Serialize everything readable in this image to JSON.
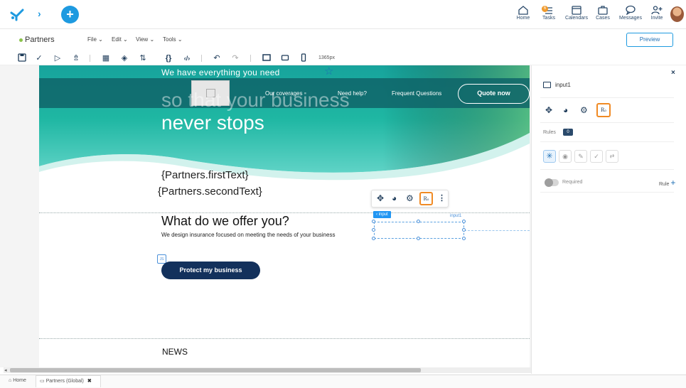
{
  "topbar": {
    "tasks_badge": "6",
    "nav": [
      {
        "id": "home",
        "label": "Home",
        "icon": "home-icon"
      },
      {
        "id": "tasks",
        "label": "Tasks",
        "icon": "tasks-icon"
      },
      {
        "id": "calendars",
        "label": "Calendars",
        "icon": "calendar-icon"
      },
      {
        "id": "cases",
        "label": "Cases",
        "icon": "briefcase-icon"
      },
      {
        "id": "messages",
        "label": "Messages",
        "icon": "chat-icon"
      },
      {
        "id": "invite",
        "label": "Invite",
        "icon": "add-user-icon"
      }
    ],
    "accent": "#1e9ae0"
  },
  "menubar": {
    "title": "Partners",
    "status_color": "#8bc34a",
    "menus": [
      "File",
      "Edit",
      "View",
      "Tools"
    ],
    "preview_label": "Preview"
  },
  "toolbar": {
    "width_label": "1365px"
  },
  "page": {
    "banner_text": "We have everything you need",
    "nav_links": [
      "Our coverages",
      "Need help?",
      "Frequent Questions"
    ],
    "quote_button": "Quote now",
    "hero_line1": "so that your business",
    "hero_line2": "never stops",
    "first_text": "{Partners.firstText}",
    "second_text": "{Partners.secondText}",
    "offer_title": "What do we offer you?",
    "offer_sub": "We design insurance focused on meeting the needs of your business",
    "protect_button": "Protect my business",
    "js_badge": "JS",
    "news_title": "NEWS",
    "input_tag": "‹ input",
    "input_name": "input1",
    "hero_gradient_top": "#1ba59a",
    "hero_gradient_bottom": "#0e6e73",
    "button_navy": "#13315c"
  },
  "panel": {
    "element_name": "input1",
    "rules_label": "Rules",
    "rules_count": "0",
    "required_label": "Required",
    "rule_label": "Rule"
  },
  "bottombar": {
    "home_tab": "Home",
    "partners_tab": "Partners (Global)"
  }
}
